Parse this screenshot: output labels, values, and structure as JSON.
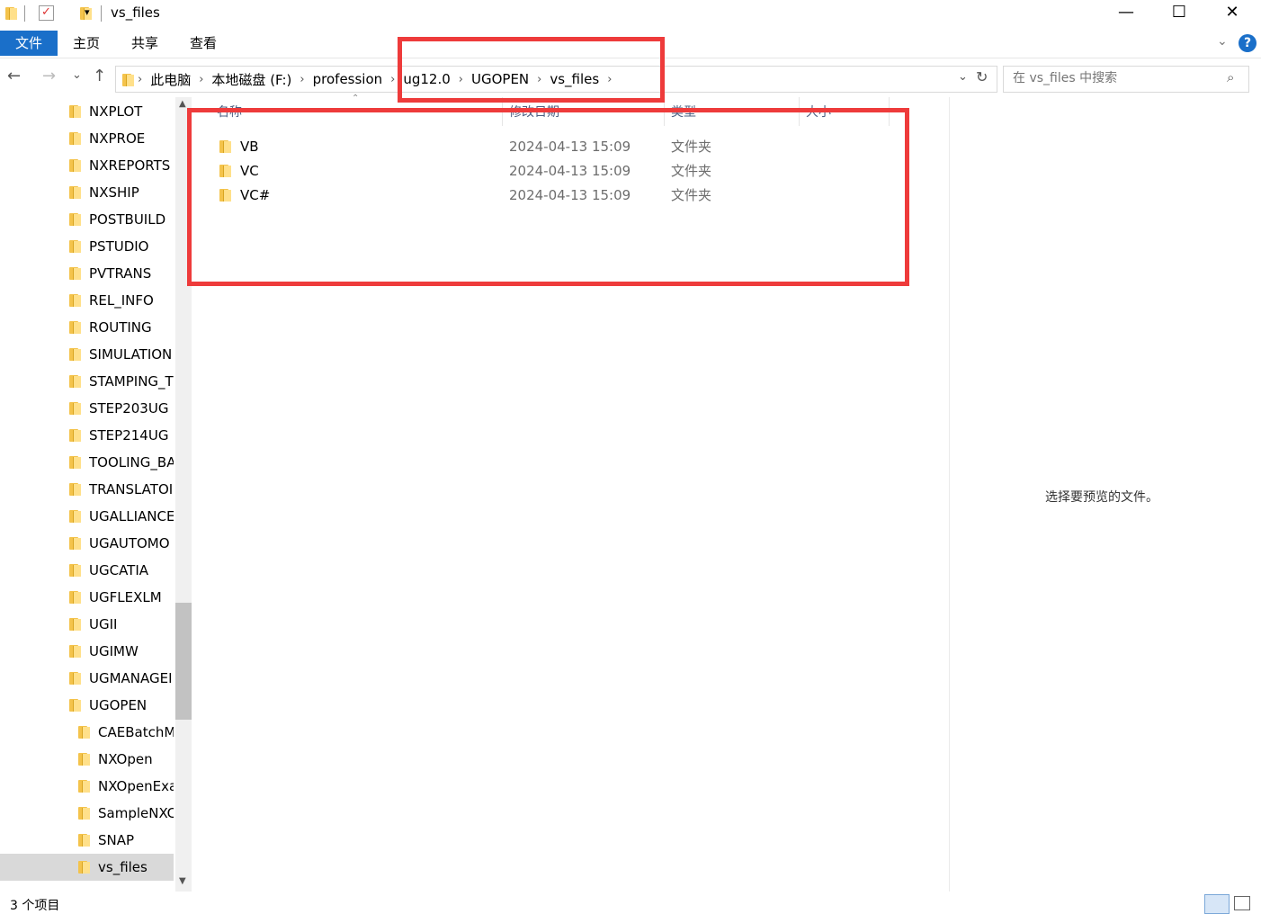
{
  "window": {
    "title": "vs_files",
    "minimize": "—",
    "maximize": "☐",
    "close": "✕"
  },
  "ribbon": {
    "tabs": [
      "文件",
      "主页",
      "共享",
      "查看"
    ],
    "help": "?"
  },
  "address": {
    "crumbs": [
      "此电脑",
      "本地磁盘 (F:)",
      "profession",
      "ug12.0",
      "UGOPEN",
      "vs_files"
    ]
  },
  "search": {
    "placeholder": "在 vs_files 中搜索"
  },
  "nav": {
    "items": [
      {
        "label": "NXPLOT",
        "indent": 0
      },
      {
        "label": "NXPROE",
        "indent": 0
      },
      {
        "label": "NXREPORTS",
        "indent": 0
      },
      {
        "label": "NXSHIP",
        "indent": 0
      },
      {
        "label": "POSTBUILD",
        "indent": 0
      },
      {
        "label": "PSTUDIO",
        "indent": 0
      },
      {
        "label": "PVTRANS",
        "indent": 0
      },
      {
        "label": "REL_INFO",
        "indent": 0
      },
      {
        "label": "ROUTING",
        "indent": 0
      },
      {
        "label": "SIMULATION",
        "indent": 0
      },
      {
        "label": "STAMPING_T",
        "indent": 0
      },
      {
        "label": "STEP203UG",
        "indent": 0
      },
      {
        "label": "STEP214UG",
        "indent": 0
      },
      {
        "label": "TOOLING_BA",
        "indent": 0
      },
      {
        "label": "TRANSLATOI",
        "indent": 0
      },
      {
        "label": "UGALLIANCE",
        "indent": 0
      },
      {
        "label": "UGAUTOMO",
        "indent": 0
      },
      {
        "label": "UGCATIA",
        "indent": 0
      },
      {
        "label": "UGFLEXLM",
        "indent": 0
      },
      {
        "label": "UGII",
        "indent": 0
      },
      {
        "label": "UGIMW",
        "indent": 0
      },
      {
        "label": "UGMANAGEI",
        "indent": 0
      },
      {
        "label": "UGOPEN",
        "indent": 0
      },
      {
        "label": "CAEBatchM",
        "indent": 1
      },
      {
        "label": "NXOpen",
        "indent": 1
      },
      {
        "label": "NXOpenExa",
        "indent": 1
      },
      {
        "label": "SampleNXC",
        "indent": 1
      },
      {
        "label": "SNAP",
        "indent": 1
      },
      {
        "label": "vs_files",
        "indent": 1,
        "selected": true
      }
    ]
  },
  "columns": [
    "名称",
    "修改日期",
    "类型",
    "大小"
  ],
  "files": [
    {
      "name": "VB",
      "modified": "2024-04-13 15:09",
      "type": "文件夹"
    },
    {
      "name": "VC",
      "modified": "2024-04-13 15:09",
      "type": "文件夹"
    },
    {
      "name": "VC#",
      "modified": "2024-04-13 15:09",
      "type": "文件夹"
    }
  ],
  "preview": {
    "message": "选择要预览的文件。"
  },
  "status": {
    "count": "3 个项目"
  },
  "colors": {
    "accent": "#1a6fc9",
    "highlight_box": "#ee3b3b"
  }
}
